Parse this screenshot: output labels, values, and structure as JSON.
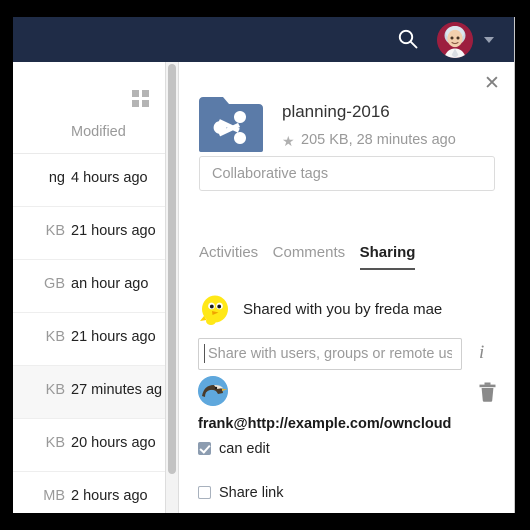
{
  "topbar": {
    "search_icon": "search-icon",
    "avatar_icon": "user-avatar",
    "dropdown_icon": "chevron-down-icon",
    "background_color": "#1f2c47",
    "avatar_background": "#9d1e3f"
  },
  "filelist": {
    "grid_toggle_icon": "grid-view-icon",
    "columns": {
      "modified": "Modified"
    },
    "rows": [
      {
        "size": "ng",
        "modified": "4 hours ago",
        "selected": false,
        "size_dark": true
      },
      {
        "size": "KB",
        "modified": "21 hours ago",
        "selected": false,
        "size_dark": false
      },
      {
        "size": "GB",
        "modified": "an hour ago",
        "selected": false,
        "size_dark": false
      },
      {
        "size": "KB",
        "modified": "21 hours ago",
        "selected": false,
        "size_dark": false
      },
      {
        "size": "KB",
        "modified": "27 minutes ag",
        "selected": true,
        "size_dark": false
      },
      {
        "size": "KB",
        "modified": "20 hours ago",
        "selected": false,
        "size_dark": false
      },
      {
        "size": "MB",
        "modified": "2 hours ago",
        "selected": false,
        "size_dark": false
      }
    ]
  },
  "sidebar": {
    "close_label": "✕",
    "file_icon": "shared-folder-icon",
    "file_icon_color": "#5b7ba8",
    "filename": "planning-2016",
    "favorite_star": "★",
    "file_meta": "205 KB, 28 minutes ago",
    "tags": {
      "value": "",
      "placeholder": "Collaborative tags"
    },
    "tabs": [
      {
        "label": "Activities",
        "active": false
      },
      {
        "label": "Comments",
        "active": false
      },
      {
        "label": "Sharing",
        "active": true
      }
    ],
    "shared_by": {
      "avatar_icon": "tweety-bird-avatar",
      "text": "Shared with you by freda mae"
    },
    "share_field": {
      "value": "",
      "placeholder": "Share with users, groups or remote users"
    },
    "info_icon": "info-icon",
    "sharee": {
      "avatar_icon": "eagle-avatar",
      "name": "frank@http://example.com/owncloud",
      "delete_icon": "trash-icon"
    },
    "permissions": [
      {
        "label": "can edit",
        "checked": true
      },
      {
        "label": "Share link",
        "checked": false
      }
    ]
  }
}
